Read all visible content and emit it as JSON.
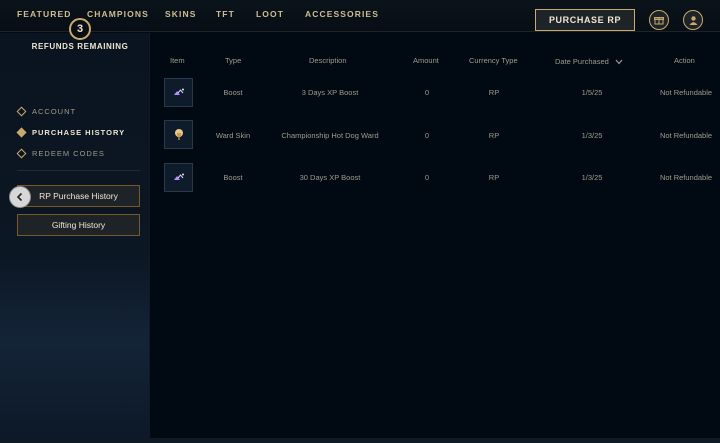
{
  "topnav": {
    "tabs": [
      "FEATURED",
      "CHAMPIONS",
      "SKINS",
      "TFT",
      "LOOT",
      "ACCESSORIES"
    ],
    "purchase_label": "PURCHASE RP",
    "icons": [
      "gift-icon",
      "profile-icon"
    ]
  },
  "sidebar": {
    "refunds_count": "3",
    "refunds_label": "REFUNDS REMAINING",
    "items": [
      {
        "label": "ACCOUNT",
        "icon": "diamond-icon",
        "active": false
      },
      {
        "label": "PURCHASE HISTORY",
        "icon": "diamond-icon",
        "active": true
      },
      {
        "label": "REDEEM CODES",
        "icon": "diamond-icon",
        "active": false
      }
    ],
    "sub_buttons": [
      {
        "label": "RP Purchase History"
      },
      {
        "label": "Gifting History"
      }
    ]
  },
  "table": {
    "headers": [
      "Item",
      "Type",
      "Description",
      "Amount",
      "Currency Type",
      "Date Purchased",
      "Action"
    ],
    "sort_icon": "chevron-down-icon",
    "rows": [
      {
        "icon": "xp-boost-icon",
        "type": "Boost",
        "description": "3 Days XP Boost",
        "amount": "0",
        "currency": "RP",
        "date": "1/5/25",
        "action": "Not Refundable"
      },
      {
        "icon": "ward-skin-icon",
        "type": "Ward Skin",
        "description": "Championship Hot Dog Ward",
        "amount": "0",
        "currency": "RP",
        "date": "1/3/25",
        "action": "Not Refundable"
      },
      {
        "icon": "xp-boost-icon",
        "type": "Boost",
        "description": "30 Days XP Boost",
        "amount": "0",
        "currency": "RP",
        "date": "1/3/25",
        "action": "Not Refundable"
      }
    ]
  },
  "colors": {
    "gold": "#c8aa6e",
    "text_light": "#f0e6d2",
    "text_muted": "#a09b8c",
    "background": "#010a13"
  }
}
